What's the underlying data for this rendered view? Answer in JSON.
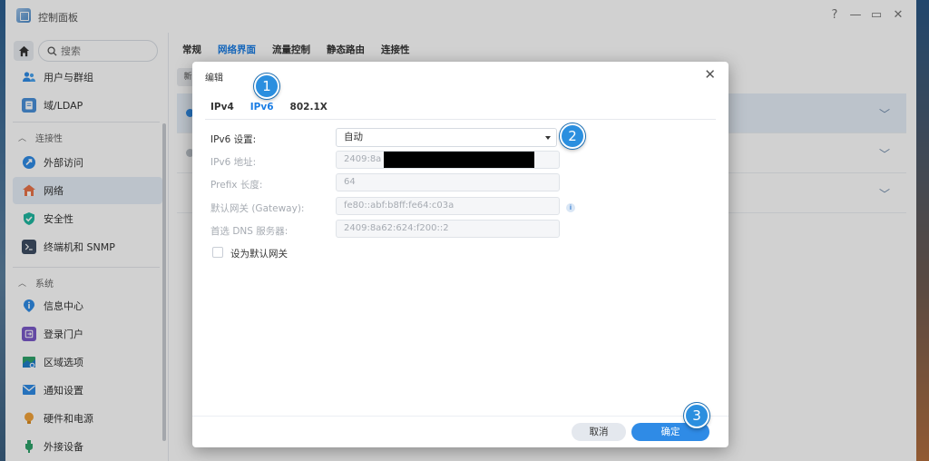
{
  "window": {
    "title": "控制面板",
    "controls": [
      "?",
      "—",
      "▭",
      "✕"
    ]
  },
  "sidebar": {
    "search_placeholder": "搜索",
    "items": [
      {
        "label": "用户与群组",
        "icon": "users-icon"
      },
      {
        "label": "域/LDAP",
        "icon": "ldap-icon"
      },
      {
        "section": "连接性"
      },
      {
        "label": "外部访问",
        "icon": "external-access-icon"
      },
      {
        "label": "网络",
        "icon": "network-icon",
        "active": true
      },
      {
        "label": "安全性",
        "icon": "shield-icon"
      },
      {
        "label": "终端机和 SNMP",
        "icon": "terminal-icon"
      },
      {
        "section": "系统"
      },
      {
        "label": "信息中心",
        "icon": "info-center-icon"
      },
      {
        "label": "登录门户",
        "icon": "login-portal-icon"
      },
      {
        "label": "区域选项",
        "icon": "region-icon"
      },
      {
        "label": "通知设置",
        "icon": "notification-icon"
      },
      {
        "label": "硬件和电源",
        "icon": "hardware-power-icon"
      },
      {
        "label": "外接设备",
        "icon": "external-device-icon"
      }
    ]
  },
  "main": {
    "tabs": [
      "常规",
      "网络界面",
      "流量控制",
      "静态路由",
      "连接性"
    ],
    "active_tab": "网络界面",
    "subtab_label": "新"
  },
  "dialog": {
    "title": "编辑",
    "tabs": [
      "IPv4",
      "IPv6",
      "802.1X"
    ],
    "active_tab": "IPv6",
    "fields": {
      "ipv6_setting_label": "IPv6 设置:",
      "ipv6_setting_value": "自动",
      "ipv6_address_label": "IPv6 地址:",
      "ipv6_address_value": "2409:8a",
      "prefix_label": "Prefix 长度:",
      "prefix_value": "64",
      "gateway_label": "默认网关 (Gateway):",
      "gateway_value": "fe80::abf:b8ff:fe64:c03a",
      "dns_label": "首选 DNS 服务器:",
      "dns_value": "2409:8a62:624:f200::2",
      "default_gateway_checkbox": "设为默认网关",
      "default_gateway_checked": false
    },
    "cancel_label": "取消",
    "ok_label": "确定"
  },
  "callouts": [
    "1",
    "2",
    "3"
  ],
  "colors": {
    "accent": "#1a7de4",
    "callout": "#2b8fdf",
    "primary_button": "#2f8be6"
  }
}
